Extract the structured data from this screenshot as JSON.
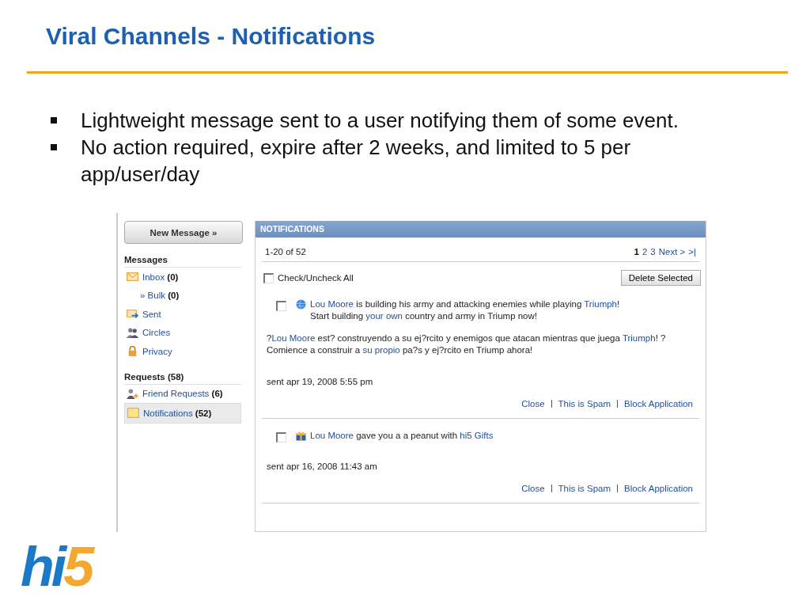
{
  "slide": {
    "title": "Viral Channels - Notifications",
    "bullets": [
      "Lightweight message sent to a user notifying them of some event.",
      "No action required, expire after 2 weeks, and limited to 5 per app/user/day"
    ]
  },
  "sidebar": {
    "new_message": "New Message »",
    "sections": [
      {
        "heading": "Messages",
        "items": [
          {
            "kind": "envelope",
            "label": "Inbox",
            "count": "(0)",
            "selected": false,
            "children": [
              {
                "prefix": "»",
                "label": "Bulk",
                "count": "(0)",
                "selected": false
              }
            ]
          },
          {
            "kind": "sent",
            "label": "Sent",
            "selected": false
          },
          {
            "kind": "people",
            "label": "Circles",
            "selected": false
          },
          {
            "kind": "lock",
            "label": "Privacy",
            "selected": false
          }
        ]
      },
      {
        "heading": "Requests (58)",
        "items": [
          {
            "kind": "friend",
            "label": "Friend Requests",
            "count": "(6)",
            "selected": false
          },
          {
            "kind": "note",
            "label": "Notifications",
            "count": "(52)",
            "selected": true
          }
        ]
      }
    ]
  },
  "panel": {
    "title": "NOTIFICATIONS",
    "range": "1-20 of 52",
    "pages": [
      {
        "label": "1",
        "selected": true
      },
      {
        "label": "2",
        "selected": false
      },
      {
        "label": "3",
        "selected": false
      },
      {
        "label": "Next >",
        "selected": false
      },
      {
        "label": ">|",
        "selected": false
      }
    ],
    "check_all": {
      "label": "Check/Uncheck All",
      "checked": false
    },
    "delete_button": "Delete Selected",
    "notifications": [
      {
        "kind": "game",
        "checked": false,
        "message": [
          [
            {
              "text": "Lou Moore",
              "link": true
            },
            {
              "text": " is building his army and attacking enemies while playing ",
              "link": false
            },
            {
              "text": "Triumph",
              "link": true
            },
            {
              "text": "!",
              "link": false
            }
          ],
          [
            {
              "text": "Start building ",
              "link": false
            },
            {
              "text": "your own",
              "link": true
            },
            {
              "text": " country and army in Triump now!",
              "link": false
            }
          ]
        ],
        "translation": [
          {
            "text": "?",
            "link": false
          },
          {
            "text": "Lou Moore",
            "link": true
          },
          {
            "text": " est? construyendo a su ej?rcito y enemigos que atacan mientras que juega ",
            "link": false
          },
          {
            "text": "Triumph",
            "link": true
          },
          {
            "text": "! ?Comience a construir a ",
            "link": false
          },
          {
            "text": "su propio",
            "link": true
          },
          {
            "text": " pa?s y ej?rcito en Triump ahora!",
            "link": false
          }
        ],
        "sent": "sent apr 19, 2008 5:55 pm",
        "actions": [
          "Close",
          "This is Spam",
          "Block Application"
        ]
      },
      {
        "kind": "gift",
        "checked": false,
        "message": [
          [
            {
              "text": "Lou Moore",
              "link": true
            },
            {
              "text": " gave you a a peanut with ",
              "link": false
            },
            {
              "text": "hi5 Gifts",
              "link": true
            }
          ]
        ],
        "sent": "sent apr 16, 2008 11:43 am",
        "actions": [
          "Close",
          "This is Spam",
          "Block Application"
        ]
      }
    ]
  },
  "logo": [
    "hi",
    "5"
  ]
}
